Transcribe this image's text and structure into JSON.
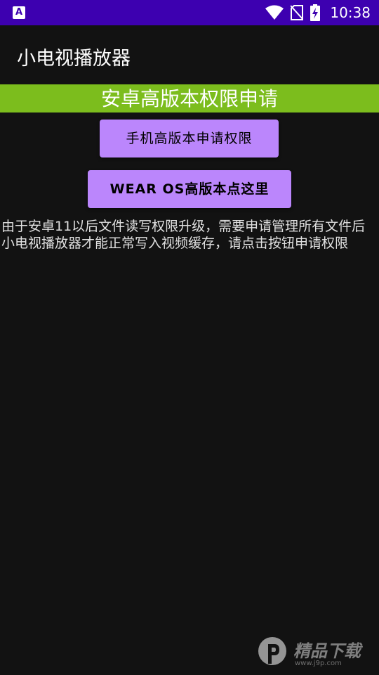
{
  "status_bar": {
    "app_icon_letter": "A",
    "time": "10:38",
    "icons": [
      "wifi-icon",
      "no-sim-icon",
      "battery-charging-icon"
    ]
  },
  "app_bar": {
    "title": "小电视播放器"
  },
  "banner": {
    "text": "安卓高版本权限申请"
  },
  "buttons": {
    "phone_label": "手机高版本申请权限",
    "wear_label": "WEAR OS高版本点这里"
  },
  "description": "由于安卓11以后文件读写权限升级，需要申请管理所有文件后小电视播放器才能正常写入视频缓存，请点击按钮申请权限",
  "watermark": {
    "text": "精品下载",
    "url": "www.j9p.com"
  },
  "colors": {
    "status_bar": "#3d00b0",
    "background": "#121212",
    "banner": "#7cbd1d",
    "button": "#bb86fc"
  }
}
